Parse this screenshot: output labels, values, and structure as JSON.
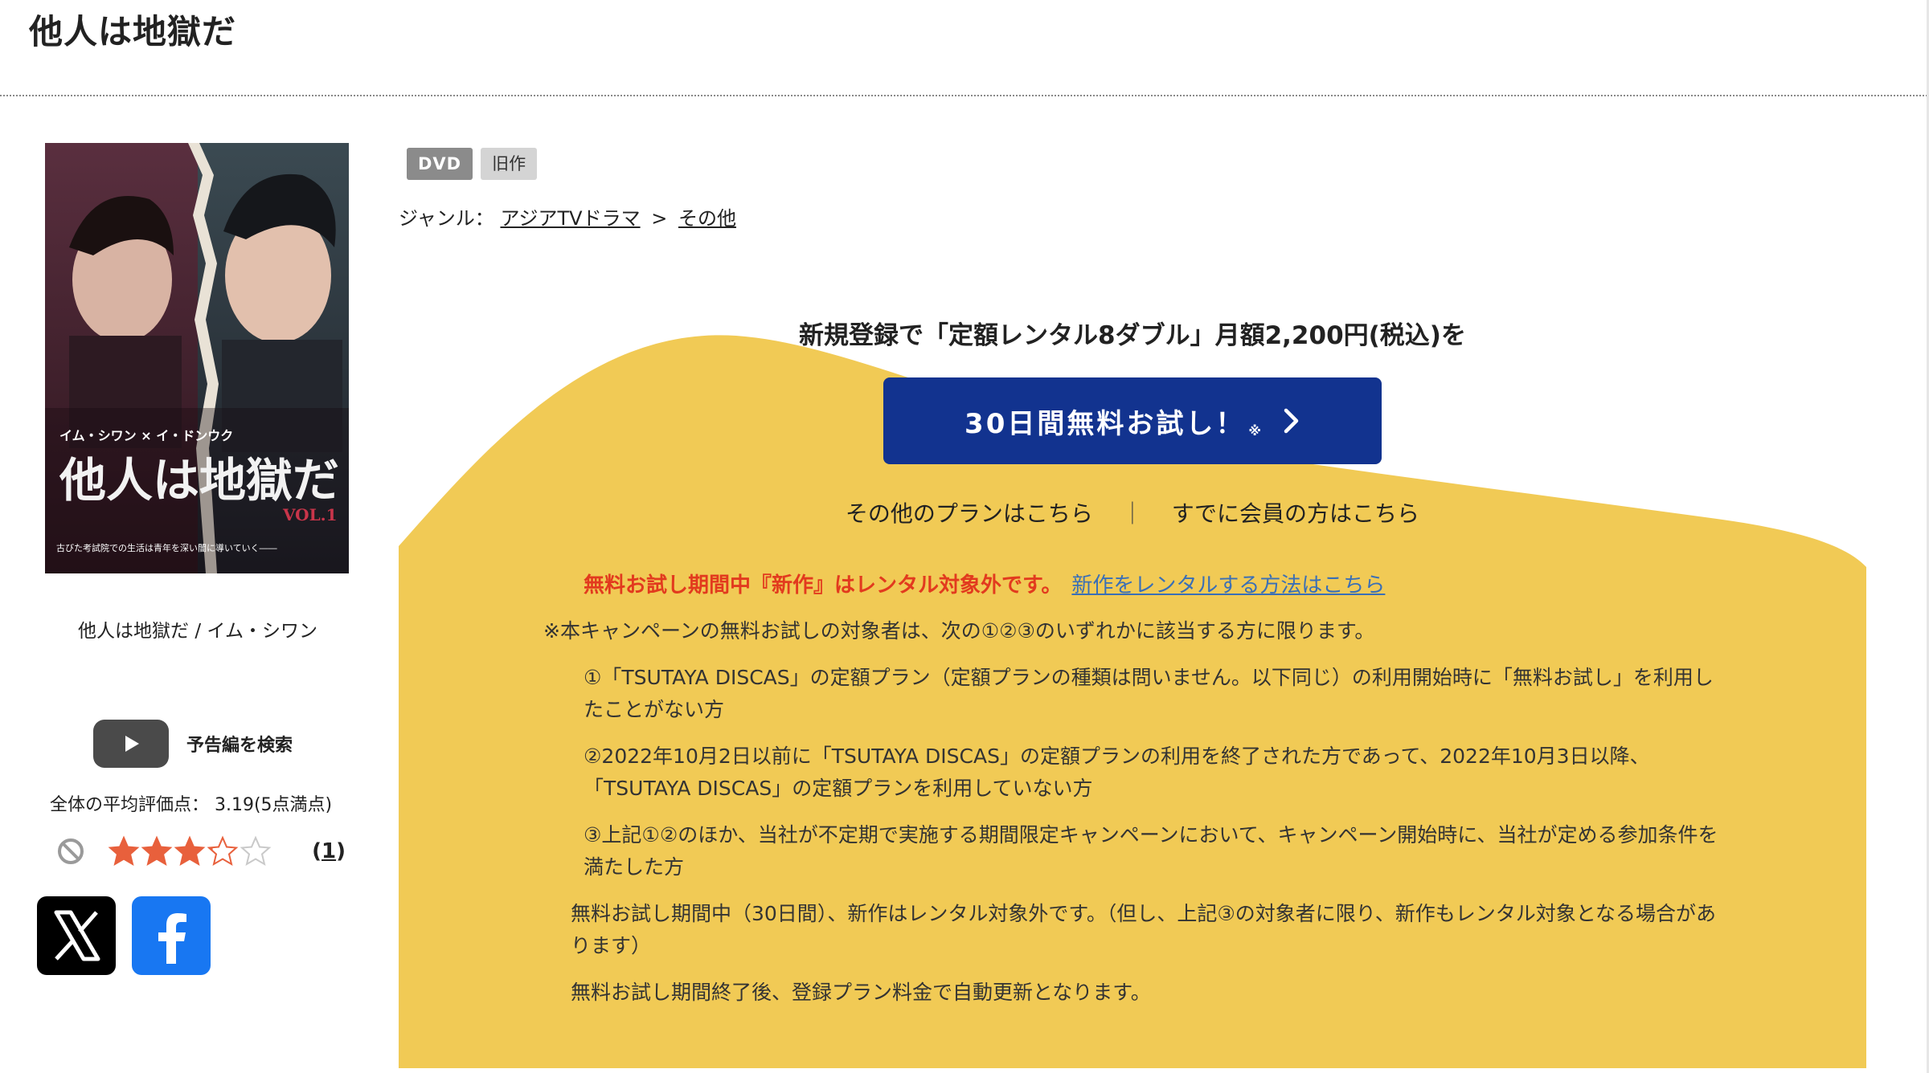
{
  "page": {
    "title": "他人は地獄だ"
  },
  "product": {
    "cover_alt": "他人は地獄だ",
    "name_line": "他人は地獄だ / イム・シワン",
    "trailer_label": "予告編を検索",
    "average_rating_text": "全体の平均評価点： 3.19(5点満点)",
    "rating": 3.19,
    "rating_max": 5,
    "review_count": "1",
    "social": {
      "x": "X",
      "facebook": "f"
    },
    "cover_text": {
      "cast": "イム・シワン × イ・ドンウク",
      "title": "他人は地獄だ",
      "vol": "VOL.1",
      "tagline": "古びた考試院での生活は青年を深い闇に導いていく――"
    }
  },
  "badges": [
    "DVD",
    "旧作"
  ],
  "genre": {
    "label": "ジャンル：",
    "items": [
      "アジアTVドラマ",
      "その他"
    ],
    "separator": ">"
  },
  "promo": {
    "headline": "新規登録で「定額レンタル8ダブル」月額2,200円(税込)を",
    "cta_label": "30日間無料お試し！",
    "cta_mark": "※",
    "other_plans": "その他のプランはこちら",
    "divider": "｜",
    "members": "すでに会員の方はこちら",
    "warning": "無料お試し期間中『新作』はレンタル対象外です。",
    "warning_link": "新作をレンタルする方法はこちら",
    "terms_intro": "※本キャンペーンの無料お試しの対象者は、次の①②③のいずれかに該当する方に限ります。",
    "terms": [
      "①「TSUTAYA DISCAS」の定額プラン（定額プランの種類は問いません。以下同じ）の利用開始時に「無料お試し」を利用したことがない方",
      "②2022年10月2日以前に「TSUTAYA DISCAS」の定額プランの利用を終了された方であって、2022年10月3日以降、「TSUTAYA DISCAS」の定額プランを利用していない方",
      "③上記①②のほか、当社が不定期で実施する期間限定キャンペーンにおいて、キャンペーン開始時に、当社が定める参加条件を満たした方"
    ],
    "note_1": "無料お試し期間中（30日間）、新作はレンタル対象外です。（但し、上記③の対象者に限り、新作もレンタル対象となる場合があります）",
    "note_2": "無料お試し期間終了後、登録プラン料金で自動更新となります。"
  },
  "colors": {
    "promo_yellow": "#f1ca55",
    "cta_blue": "#12338f",
    "warning_red": "#e23a1e",
    "link_blue": "#3a6fb6",
    "star_orange": "#e8603c"
  }
}
